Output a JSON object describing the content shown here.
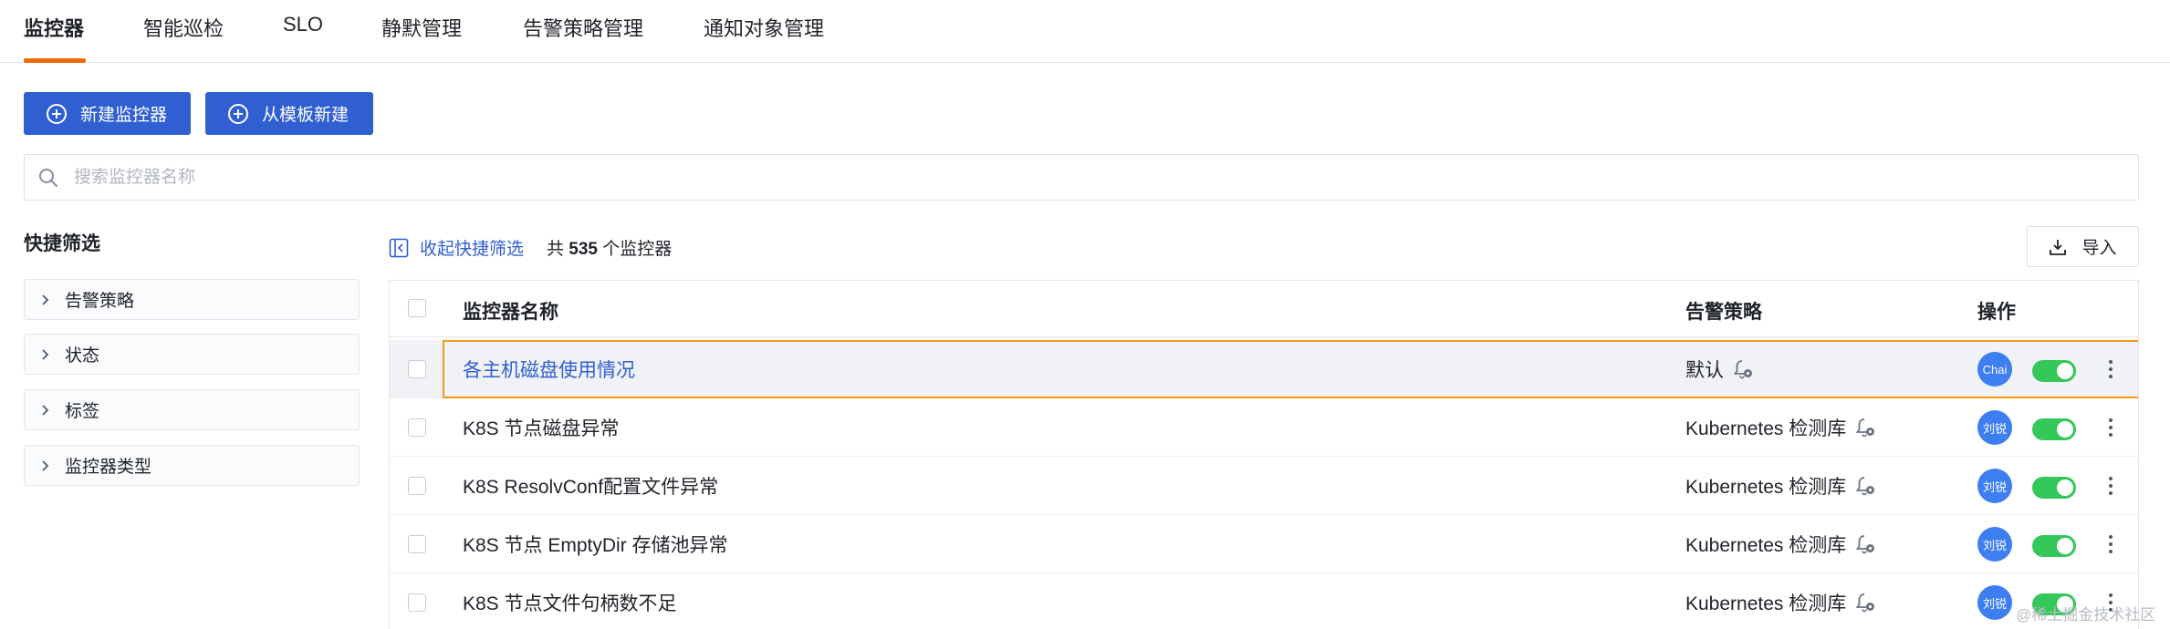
{
  "tabs": [
    {
      "label": "监控器",
      "active": true
    },
    {
      "label": "智能巡检",
      "active": false
    },
    {
      "label": "SLO",
      "active": false
    },
    {
      "label": "静默管理",
      "active": false
    },
    {
      "label": "告警策略管理",
      "active": false
    },
    {
      "label": "通知对象管理",
      "active": false
    }
  ],
  "actions": {
    "new_monitor": "新建监控器",
    "from_template": "从模板新建"
  },
  "search": {
    "placeholder": "搜索监控器名称",
    "value": ""
  },
  "quick_filter": {
    "title": "快捷筛选",
    "items": [
      "告警策略",
      "状态",
      "标签",
      "监控器类型"
    ]
  },
  "toolbar": {
    "collapse_label": "收起快捷筛选",
    "count_prefix": "共",
    "count": "535",
    "count_suffix": "个监控器",
    "import_label": "导入"
  },
  "table": {
    "columns": {
      "name": "监控器名称",
      "policy": "告警策略",
      "actions": "操作"
    },
    "rows": [
      {
        "name": "各主机磁盘使用情况",
        "policy": "默认",
        "owner": "Chai",
        "enabled": true,
        "selected": true
      },
      {
        "name": "K8S 节点磁盘异常",
        "policy": "Kubernetes 检测库",
        "owner": "刘锐",
        "enabled": true,
        "selected": false
      },
      {
        "name": "K8S ResolvConf配置文件异常",
        "policy": "Kubernetes 检测库",
        "owner": "刘锐",
        "enabled": true,
        "selected": false
      },
      {
        "name": "K8S 节点 EmptyDir 存储池异常",
        "policy": "Kubernetes 检测库",
        "owner": "刘锐",
        "enabled": true,
        "selected": false
      },
      {
        "name": "K8S 节点文件句柄数不足",
        "policy": "Kubernetes 检测库",
        "owner": "刘锐",
        "enabled": true,
        "selected": false
      }
    ]
  },
  "watermark": "@稀土掘金技术社区",
  "colors": {
    "primary": "#2f5fd0",
    "tab_accent": "#ec6a0a",
    "selection_border": "#f19a1b",
    "toggle_on": "#34c759",
    "avatar": "#3d7ef0"
  },
  "icons": {
    "add": "plus-circle-icon",
    "search": "search-icon",
    "expand": "chevron-right-icon",
    "collapse": "collapse-panel-icon",
    "import": "download-icon",
    "policy": "bell-gear-icon",
    "more": "more-vertical-icon"
  }
}
